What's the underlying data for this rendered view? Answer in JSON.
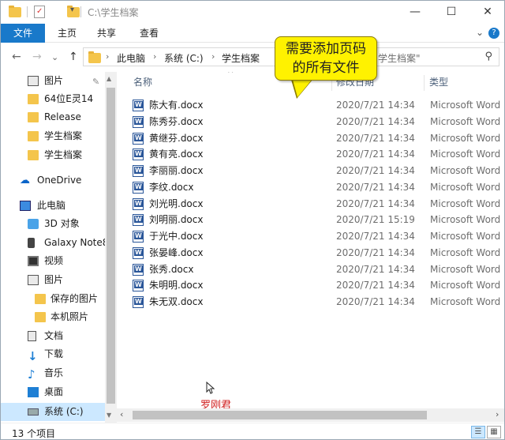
{
  "window": {
    "title": "C:\\学生档案",
    "qa_dropdown": "▾",
    "minimize": "—",
    "maximize": "☐",
    "close": "✕"
  },
  "ribbon": {
    "tabs": [
      "文件",
      "主页",
      "共享",
      "查看"
    ],
    "expand_chevron": "⌄",
    "help": "?"
  },
  "address": {
    "back": "←",
    "forward": "→",
    "recent": "⌄",
    "up": "↑",
    "crumbs": [
      "此电脑",
      "系统 (C:)",
      "学生档案"
    ],
    "crumb_sep": "›",
    "search_placeholder": "学生档案\"",
    "search_icon": "⚲"
  },
  "nav": {
    "items": [
      {
        "label": "图片",
        "icon": "pictures-icon",
        "pinned": true
      },
      {
        "label": "64位E灵14",
        "icon": "folder-icon"
      },
      {
        "label": "Release",
        "icon": "folder-icon"
      },
      {
        "label": "学生档案",
        "icon": "folder-icon"
      },
      {
        "label": "学生档案",
        "icon": "folder-icon"
      },
      {
        "label": "OneDrive",
        "icon": "cloud-icon"
      },
      {
        "label": "此电脑",
        "icon": "pc-icon"
      },
      {
        "label": "3D 对象",
        "icon": "3d-objects-icon"
      },
      {
        "label": "Galaxy Note8",
        "icon": "phone-icon"
      },
      {
        "label": "视频",
        "icon": "video-icon"
      },
      {
        "label": "图片",
        "icon": "pictures-icon"
      },
      {
        "label": "保存的图片",
        "icon": "folder-icon"
      },
      {
        "label": "本机照片",
        "icon": "folder-icon"
      },
      {
        "label": "文档",
        "icon": "documents-icon"
      },
      {
        "label": "下载",
        "icon": "download-icon"
      },
      {
        "label": "音乐",
        "icon": "music-icon"
      },
      {
        "label": "桌面",
        "icon": "desktop-icon"
      },
      {
        "label": "系统 (C:)",
        "icon": "drive-icon",
        "selected": true
      }
    ],
    "pin_glyph": "📌"
  },
  "columns": {
    "name": "名称",
    "date": "修改日期",
    "type": "类型",
    "sort_glyph": "^"
  },
  "files": [
    {
      "name": "陈大有.docx",
      "date": "2020/7/21 14:34",
      "type": "Microsoft Word"
    },
    {
      "name": "陈秀芬.docx",
      "date": "2020/7/21 14:34",
      "type": "Microsoft Word"
    },
    {
      "name": "黄继芬.docx",
      "date": "2020/7/21 14:34",
      "type": "Microsoft Word"
    },
    {
      "name": "黄有亮.docx",
      "date": "2020/7/21 14:34",
      "type": "Microsoft Word"
    },
    {
      "name": "李丽丽.docx",
      "date": "2020/7/21 14:34",
      "type": "Microsoft Word"
    },
    {
      "name": "李纹.docx",
      "date": "2020/7/21 14:34",
      "type": "Microsoft Word"
    },
    {
      "name": "刘光明.docx",
      "date": "2020/7/21 14:34",
      "type": "Microsoft Word"
    },
    {
      "name": "刘明丽.docx",
      "date": "2020/7/21 15:19",
      "type": "Microsoft Word"
    },
    {
      "name": "于光中.docx",
      "date": "2020/7/21 14:34",
      "type": "Microsoft Word"
    },
    {
      "name": "张晏峰.docx",
      "date": "2020/7/21 14:34",
      "type": "Microsoft Word"
    },
    {
      "name": "张秀.docx",
      "date": "2020/7/21 14:34",
      "type": "Microsoft Word"
    },
    {
      "name": "朱明明.docx",
      "date": "2020/7/21 14:34",
      "type": "Microsoft Word"
    },
    {
      "name": "朱无双.docx",
      "date": "2020/7/21 14:34",
      "type": "Microsoft Word"
    }
  ],
  "callout": {
    "line1": "需要添加页码",
    "line2": "的所有文件"
  },
  "watermark": "罗刚君",
  "status": {
    "count": "13 个项目"
  },
  "colors": {
    "accent": "#1979ca",
    "callout": "#fff200",
    "selected": "#cce8ff",
    "watermark": "#d02020"
  }
}
